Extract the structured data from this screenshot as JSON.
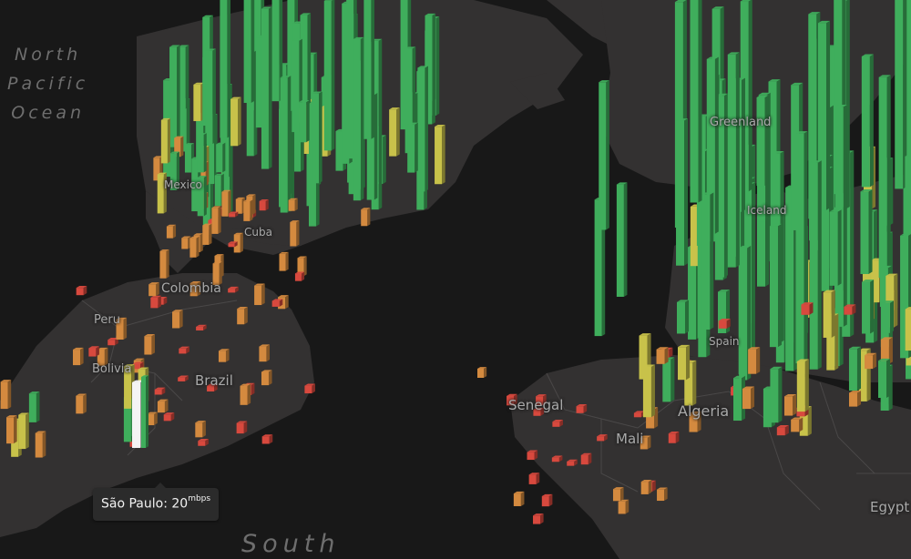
{
  "map": {
    "ocean_labels": {
      "north_pacific": [
        "North",
        "Pacific",
        "Ocean"
      ],
      "south": "South"
    },
    "place_labels": {
      "greenland": "Greenland",
      "mexico": "Mexico",
      "cuba": "Cuba",
      "colombia": "Colombia",
      "peru": "Peru",
      "bolivia": "Bolivia",
      "brazil": "Brazil",
      "senegal": "Senegal",
      "algeria": "Algeria",
      "mali": "Mali",
      "egypt": "Egypt",
      "spain": "Spain",
      "iceland": "Iceland"
    },
    "tooltip": {
      "city": "São Paulo",
      "separator": ": ",
      "value": "20",
      "unit": "mbps"
    },
    "colors": {
      "background": "#181818",
      "land": "#333131",
      "border": "#4a4848",
      "fast": "#3fae5c",
      "medium": "#c8c24a",
      "slow": "#d48a3f",
      "very_slow": "#d8493e",
      "selected": "#f4f4f4"
    }
  }
}
